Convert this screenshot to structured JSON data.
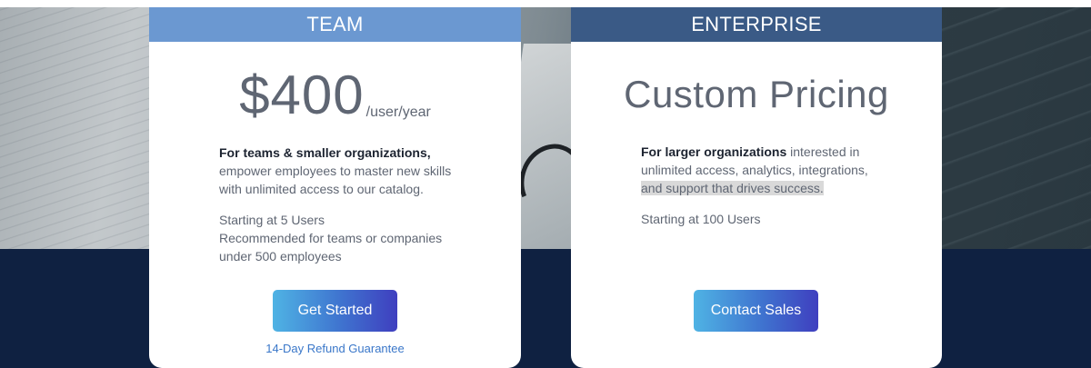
{
  "plans": {
    "team": {
      "header": "TEAM",
      "price": "$400",
      "unit": "/user/year",
      "intro_bold": "For teams & smaller organizations,",
      "intro_rest": "empower employees to master new skills with unlimited access to our catalog.",
      "details_line1": "Starting at 5 Users",
      "details_line2": "Recommended for teams or companies under 500 employees",
      "cta": "Get Started",
      "refund": "14-Day Refund Guarantee"
    },
    "enterprise": {
      "header": "ENTERPRISE",
      "price": "Custom Pricing",
      "intro_bold": "For larger organizations",
      "intro_rest": "interested in unlimited access, analytics, integrations,",
      "intro_highlight": "and support that drives success.",
      "details_line1": "Starting at 100 Users",
      "cta": "Contact Sales"
    }
  },
  "colors": {
    "team_header": "#6b98d1",
    "enterprise_header": "#3a5a86",
    "page_background": "#0f2141",
    "link": "#3a77c9"
  }
}
